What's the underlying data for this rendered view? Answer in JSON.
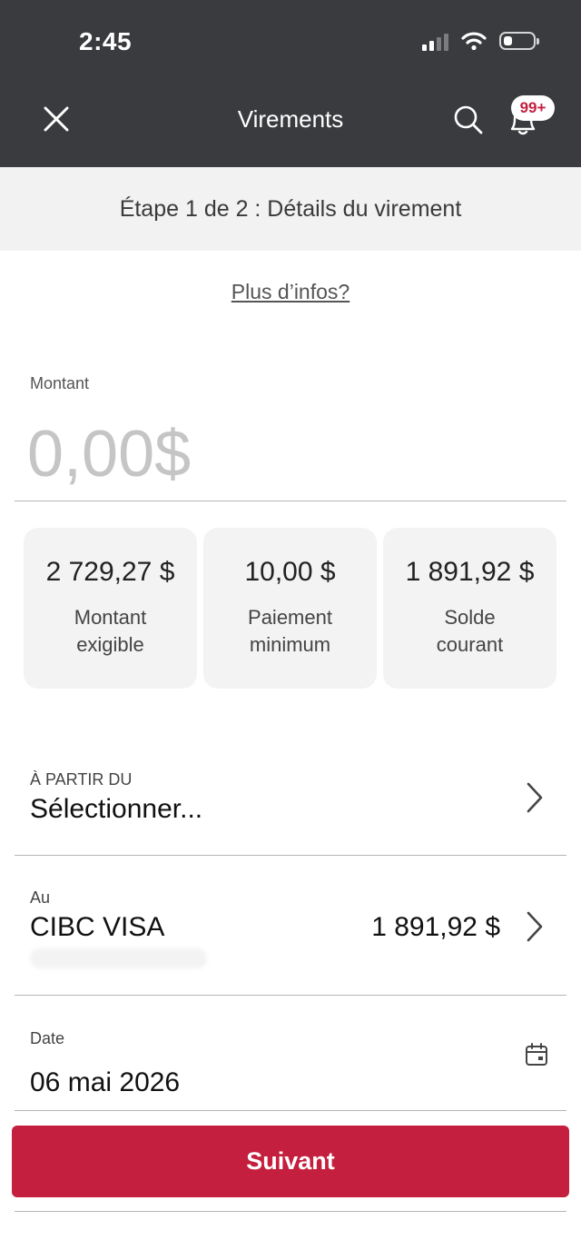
{
  "status_bar": {
    "time": "2:45"
  },
  "nav": {
    "title": "Virements",
    "badge": "99+"
  },
  "step": {
    "text": "Étape 1 de 2 : Détails du virement"
  },
  "more_info": "Plus d’infos?",
  "amount": {
    "label": "Montant",
    "placeholder": "0,00$"
  },
  "cards": [
    {
      "value": "2 729,27 $",
      "label_line1": "Montant",
      "label_line2": "exigible"
    },
    {
      "value": "10,00 $",
      "label_line1": "Paiement",
      "label_line2": "minimum"
    },
    {
      "value": "1 891,92 $",
      "label_line1": "Solde",
      "label_line2": "courant"
    }
  ],
  "from": {
    "label": "À PARTIR DU",
    "value": "Sélectionner..."
  },
  "to": {
    "label": "Au",
    "value": "CIBC VISA",
    "balance": "1 891,92 $"
  },
  "date": {
    "label": "Date",
    "value": "06 mai 2026"
  },
  "next_button": "Suivant",
  "colors": {
    "header_bg": "#3a3b3e",
    "accent": "#c41f3e",
    "step_bg": "#f2f2f2"
  }
}
